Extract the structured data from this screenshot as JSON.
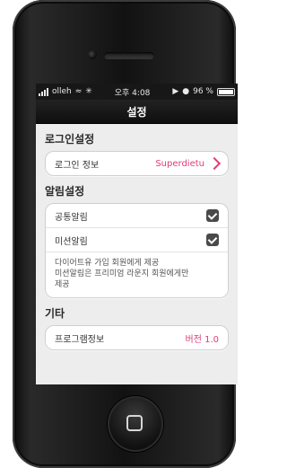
{
  "statusbar": {
    "carrier": "olleh",
    "time": "오후 4:08",
    "battery": "96 %"
  },
  "navbar": {
    "title": "설정"
  },
  "sections": {
    "login": {
      "title": "로그인설정",
      "row_label": "로그인 정보",
      "row_value": "Superdietu"
    },
    "alerts": {
      "title": "알림설정",
      "items": [
        {
          "label": "공통알림",
          "checked": true
        },
        {
          "label": "미션알림",
          "checked": true
        }
      ],
      "note_lines": [
        "다이어트유 가입 회원에게 제공",
        "미션알림은 프리미엄 라운지 회원에게만",
        "제공"
      ]
    },
    "etc": {
      "title": "기타",
      "row_label": "프로그램정보",
      "row_value": "버전 1.0"
    }
  },
  "colors": {
    "accent": "#e33b7a"
  },
  "icons": {
    "signal": "signal-bars-icon",
    "wifi": "wifi-icon",
    "loading": "spinner-icon",
    "location": "location-arrow-icon",
    "battery": "battery-icon",
    "chevron": "chevron-right-icon",
    "home": "home-button-icon"
  }
}
